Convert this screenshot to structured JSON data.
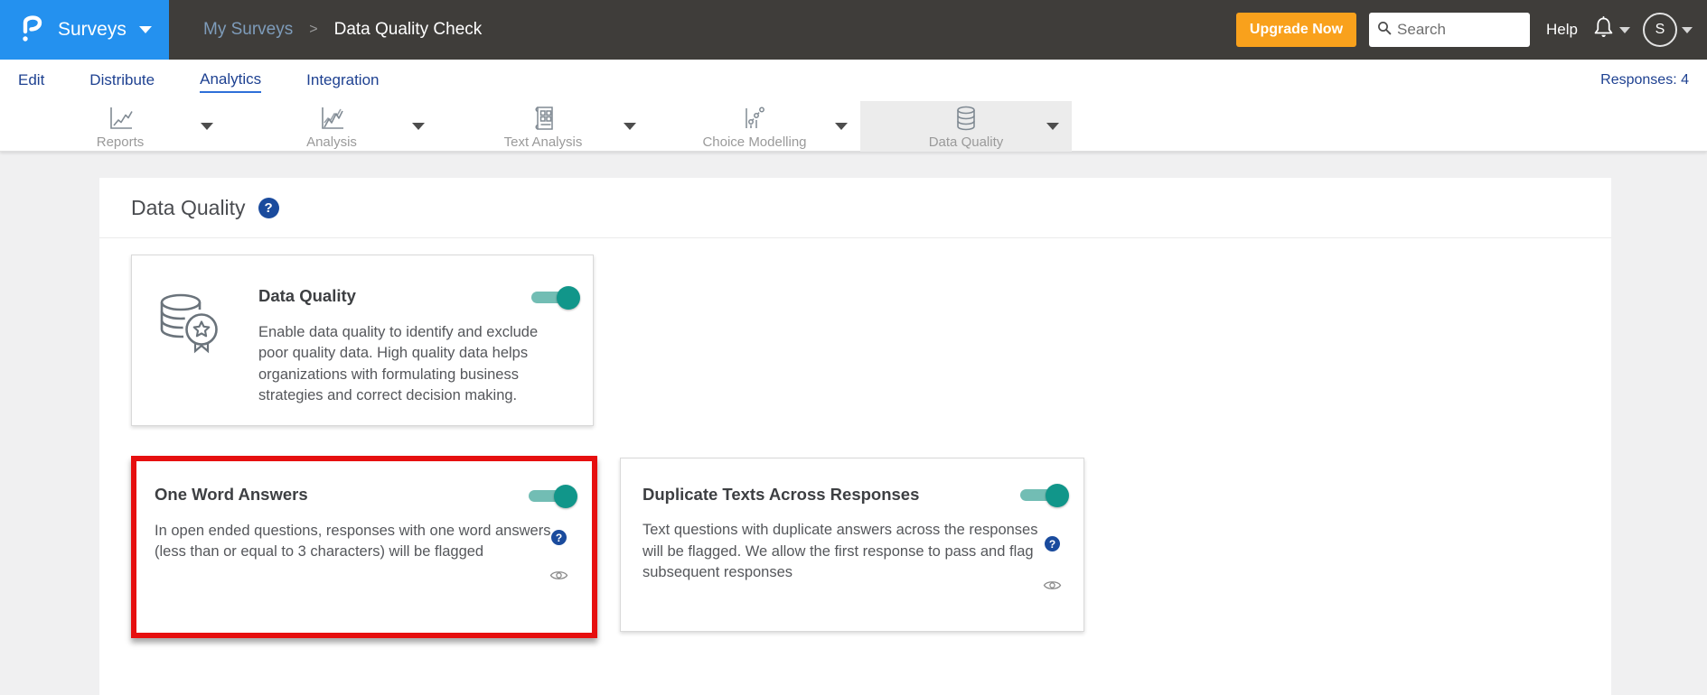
{
  "ui": {
    "help_glyph": "?"
  },
  "header": {
    "product_label": "Surveys",
    "breadcrumb": {
      "parent": "My Surveys",
      "separator": ">",
      "current": "Data Quality Check"
    },
    "upgrade_label": "Upgrade Now",
    "search_placeholder": "Search",
    "help_label": "Help",
    "avatar_initial": "S"
  },
  "nav": {
    "items": [
      {
        "label": "Edit",
        "active": false
      },
      {
        "label": "Distribute",
        "active": false
      },
      {
        "label": "Analytics",
        "active": true
      },
      {
        "label": "Integration",
        "active": false
      }
    ],
    "responses_label": "Responses: 4"
  },
  "tabs": [
    {
      "label": "Reports",
      "icon": "line-chart-icon",
      "active": false
    },
    {
      "label": "Analysis",
      "icon": "multi-line-chart-icon",
      "active": false
    },
    {
      "label": "Text Analysis",
      "icon": "document-grid-icon",
      "active": false
    },
    {
      "label": "Choice Modelling",
      "icon": "scatter-chart-icon",
      "active": false
    },
    {
      "label": "Data Quality",
      "icon": "database-icon",
      "active": true
    }
  ],
  "main": {
    "title": "Data Quality",
    "cards": [
      {
        "title": "Data Quality",
        "toggle_on": true,
        "description": "Enable data quality to identify and exclude poor quality data. High quality data helps organizations with formulating business strategies and correct decision making."
      },
      {
        "title": "One Word Answers",
        "toggle_on": true,
        "highlighted": true,
        "description": "In open ended questions, responses with one word answers (less than or equal to 3 characters) will be flagged"
      },
      {
        "title": "Duplicate Texts Across Responses",
        "toggle_on": true,
        "description": "Text questions with duplicate answers across the responses will be flagged. We allow the first response to pass and flag subsequent responses"
      }
    ]
  },
  "colors": {
    "brand_blue": "#2491ef",
    "header_bg": "#3f3d3a",
    "upgrade_orange": "#f9a11c",
    "nav_blue": "#1e4191",
    "toggle_teal": "#11968a",
    "highlight_red": "#e60f0f",
    "help_blue": "#1a4b9d"
  }
}
